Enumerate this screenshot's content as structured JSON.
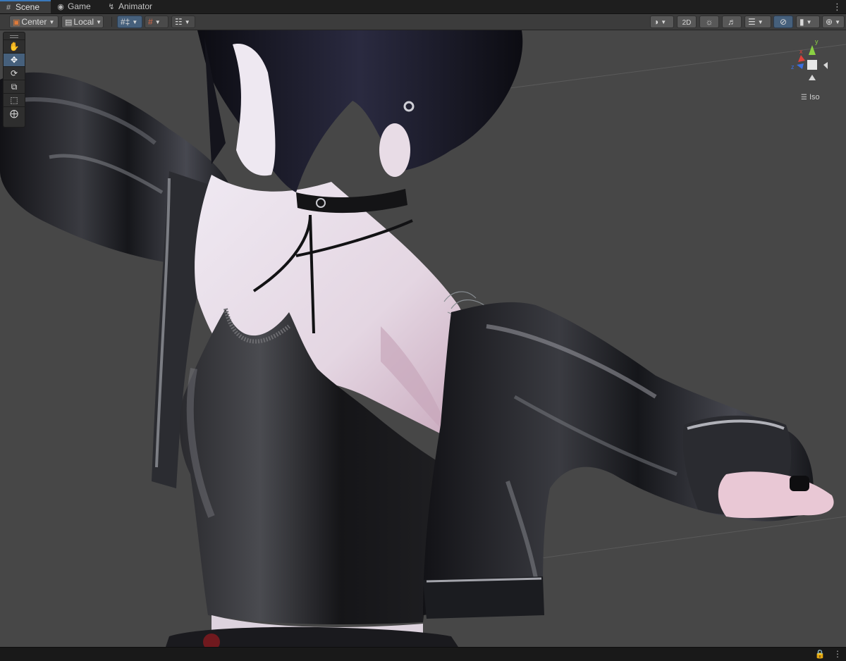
{
  "tabs": [
    {
      "label": "Scene",
      "icon": "scene-grid-icon",
      "active": true
    },
    {
      "label": "Game",
      "icon": "gamepad-icon",
      "active": false
    },
    {
      "label": "Animator",
      "icon": "animator-icon",
      "active": false
    }
  ],
  "toolbar": {
    "pivot_label": "Center",
    "space_label": "Local",
    "mode_2d_label": "2D"
  },
  "tools": [
    "hand-tool",
    "move-tool",
    "rotate-tool",
    "scale-tool",
    "rect-tool",
    "transform-tool"
  ],
  "gizmo": {
    "x_label": "x",
    "y_label": "y",
    "z_label": "z",
    "projection_label": "Iso"
  },
  "colors": {
    "accent": "#3a79bb",
    "toolbar_active": "#46607c",
    "axis_x": "#e0413a",
    "axis_y": "#8ad143",
    "axis_z": "#3b6fe0"
  }
}
